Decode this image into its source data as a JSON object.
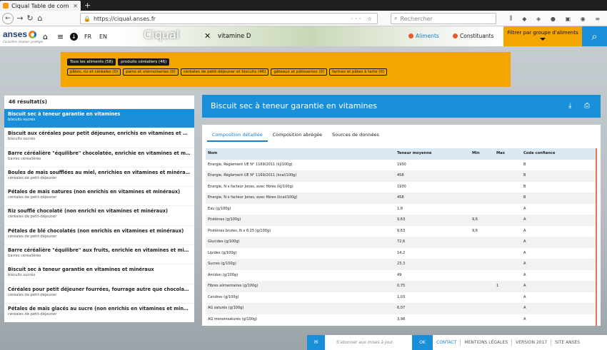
{
  "browser": {
    "tab_title": "Ciqual Table de com",
    "new_tab": "+",
    "url": "https://ciqual.anses.fr",
    "search_placeholder": "Rechercher"
  },
  "header": {
    "logo_text": "anses",
    "tagline": "Connaître, évaluer, protéger",
    "lang_fr": "FR",
    "lang_en": "EN",
    "app_name": "Ciqual",
    "search_query": "vitamine D",
    "nav_aliments": "Aliments",
    "nav_constituants": "Constituants",
    "filter_button": "Filtrer par groupe d'aliments"
  },
  "filters": {
    "breadcrumb": [
      "Tous les aliments (58)",
      "produits céréaliers (46)"
    ],
    "subgroups": [
      "pâtes, riz et céréales (0)",
      "pains et viennoiseries (0)",
      "céréales de petit-déjeuner et biscuits (46)",
      "gâteaux et pâtisseries (0)",
      "farines et pâtes à tarte (0)"
    ]
  },
  "results": {
    "count_label": "46 résultat(s)",
    "items": [
      {
        "name": "Biscuit sec à teneur garantie en vitamines",
        "category": "biscuits sucrés"
      },
      {
        "name": "Biscuit aux céréales pour petit déjeuner, enrichis en vitamines et minéraux",
        "category": "biscuits sucrés"
      },
      {
        "name": "Barre céréalière \"équilibre\" chocolatée, enrichie en vitamines et minéraux",
        "category": "barres céréalières"
      },
      {
        "name": "Boules de maïs soufflées au miel, enrichies en vitamines et minéraux",
        "category": "céréales de petit-déjeuner"
      },
      {
        "name": "Pétales de maïs natures (non enrichis en vitamines et minéraux)",
        "category": "céréales de petit-déjeuner"
      },
      {
        "name": "Riz soufflé chocolaté (non enrichi en vitamines et minéraux)",
        "category": "céréales de petit-déjeuner"
      },
      {
        "name": "Pétales de blé chocolatés (non enrichis en vitamines et minéraux)",
        "category": "céréales de petit-déjeuner"
      },
      {
        "name": "Barre céréalière \"équilibre\" aux fruits, enrichie en vitamines et minéraux",
        "category": "barres céréalières"
      },
      {
        "name": "Biscuit sec à teneur garantie en vitamines et minéraux",
        "category": "biscuits sucrés"
      },
      {
        "name": "Céréales pour petit déjeuner fourrées, fourrage autre que chocolat, enrichies...",
        "category": "céréales de petit-déjeuner"
      },
      {
        "name": "Pétales de maïs glacés au sucre (non enrichis en vitamines et minéraux)",
        "category": "céréales de petit-déjeuner"
      }
    ]
  },
  "detail": {
    "title": "Biscuit sec à teneur garantie en vitamines",
    "tabs": [
      "Composition détaillée",
      "Composition abrégée",
      "Sources de données"
    ],
    "columns": {
      "nom": "Nom",
      "teneur": "Teneur moyenne",
      "min": "Min",
      "max": "Max",
      "code": "Code confiance"
    },
    "rows": [
      {
        "nom": "Energie, Règlement UE N° 1169/2011 (kJ/100g)",
        "teneur": "1930",
        "min": "",
        "max": "",
        "code": "B"
      },
      {
        "nom": "Energie, Règlement UE N° 1169/2011 (kcal/100g)",
        "teneur": "458",
        "min": "",
        "max": "",
        "code": "B"
      },
      {
        "nom": "Energie, N x facteur Jones, avec fibres (kJ/100g)",
        "teneur": "1930",
        "min": "",
        "max": "",
        "code": "B"
      },
      {
        "nom": "Energie, N x facteur Jones, avec fibres (kcal/100g)",
        "teneur": "458",
        "min": "",
        "max": "",
        "code": "B"
      },
      {
        "nom": "Eau (g/100g)",
        "teneur": "1,8",
        "min": "",
        "max": "",
        "code": "A"
      },
      {
        "nom": "Protéines (g/100g)",
        "teneur": "9,63",
        "min": "9,6",
        "max": "",
        "code": "A"
      },
      {
        "nom": "Protéines brutes, N x 6.25 (g/100g)",
        "teneur": "9,63",
        "min": "9,6",
        "max": "",
        "code": "A"
      },
      {
        "nom": "Glucides (g/100g)",
        "teneur": "72,6",
        "min": "",
        "max": "",
        "code": "A"
      },
      {
        "nom": "Lipides (g/100g)",
        "teneur": "14,2",
        "min": "",
        "max": "",
        "code": "A"
      },
      {
        "nom": "Sucres (g/100g)",
        "teneur": "23,3",
        "min": "",
        "max": "",
        "code": "A"
      },
      {
        "nom": "Amidon (g/100g)",
        "teneur": "49",
        "min": "",
        "max": "",
        "code": "A"
      },
      {
        "nom": "Fibres alimentaires (g/100g)",
        "teneur": "0,75",
        "min": "",
        "max": "1",
        "code": "A"
      },
      {
        "nom": "Cendres (g/100g)",
        "teneur": "1,03",
        "min": "",
        "max": "",
        "code": "A"
      },
      {
        "nom": "AG saturés (g/100g)",
        "teneur": "6,07",
        "min": "",
        "max": "",
        "code": "A"
      },
      {
        "nom": "AG monoinsaturés (g/100g)",
        "teneur": "3,98",
        "min": "",
        "max": "",
        "code": "A"
      }
    ]
  },
  "footer": {
    "subscribe_placeholder": "S'abonner aux mises à jour",
    "ok": "OK",
    "contact": "CONTACT",
    "legal": "MENTIONS LÉGALES",
    "version": "VERSION 2017",
    "site": "SITE ANSES"
  }
}
